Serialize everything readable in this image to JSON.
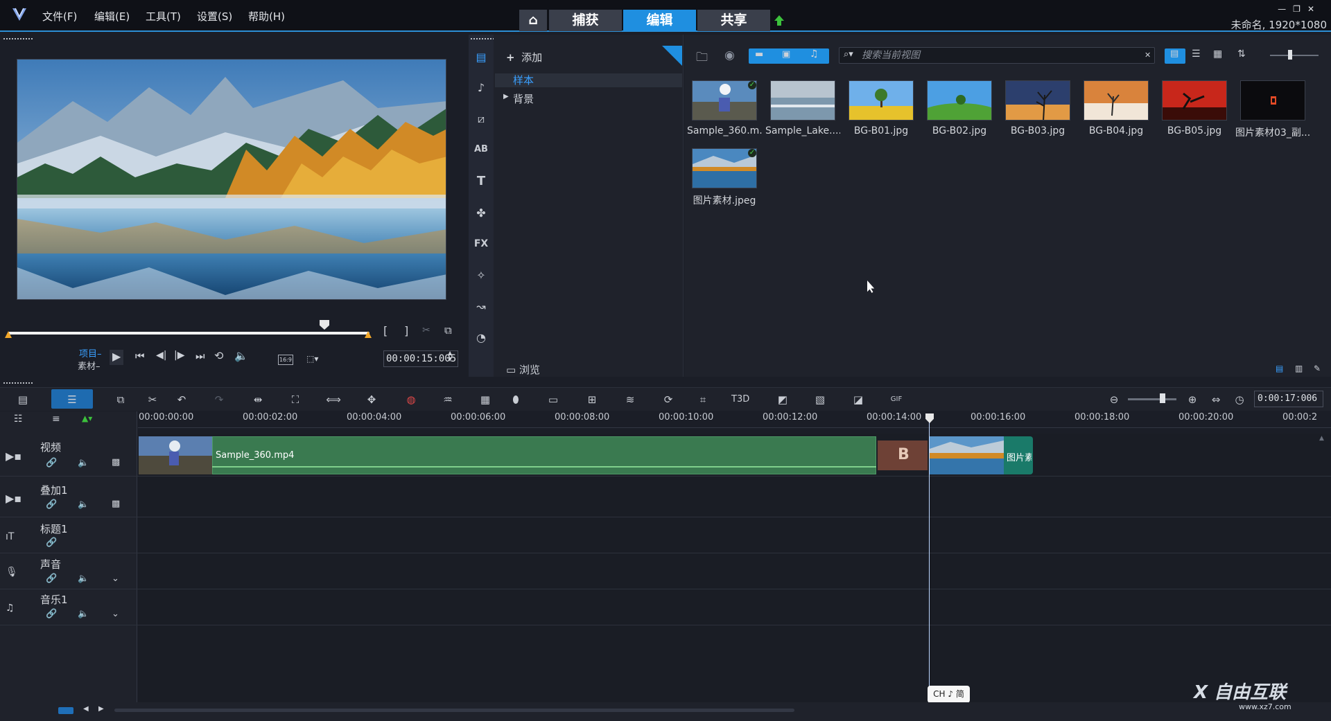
{
  "menu": [
    "文件(F)",
    "编辑(E)",
    "工具(T)",
    "设置(S)",
    "帮助(H)"
  ],
  "mode_tabs": {
    "capture": "捕获",
    "edit": "编辑",
    "share": "共享"
  },
  "project_info": "未命名, 1920*1080",
  "player": {
    "project_label": "项目",
    "clip_label": "素材",
    "timecode": "00:00:15:005",
    "aspect": "16:9"
  },
  "library": {
    "add_label": "添加",
    "tree": {
      "samples": "样本",
      "background": "背景"
    },
    "browse_label": "浏览",
    "search_placeholder": "搜索当前视图",
    "items": [
      {
        "label": "Sample_360.m...",
        "checked": true
      },
      {
        "label": "Sample_Lake....",
        "checked": false
      },
      {
        "label": "BG-B01.jpg",
        "checked": false
      },
      {
        "label": "BG-B02.jpg",
        "checked": false
      },
      {
        "label": "BG-B03.jpg",
        "checked": false
      },
      {
        "label": "BG-B04.jpg",
        "checked": false
      },
      {
        "label": "BG-B05.jpg",
        "checked": false
      },
      {
        "label": "图片素材03_副...",
        "checked": false
      },
      {
        "label": "图片素材.jpeg",
        "checked": true
      }
    ]
  },
  "timeline": {
    "timecode": "0:00:17:006",
    "ruler": [
      "00:00:00:00",
      "00:00:02:00",
      "00:00:04:00",
      "00:00:06:00",
      "00:00:08:00",
      "00:00:10:00",
      "00:00:12:00",
      "00:00:14:00",
      "00:00:16:00",
      "00:00:18:00",
      "00:00:20:00",
      "00:00:2"
    ],
    "tracks": [
      "视频",
      "叠加1",
      "标题1",
      "声音",
      "音乐1"
    ],
    "clips": {
      "video": "Sample_360.mp4",
      "image": "图片素"
    },
    "transition_letter": "B"
  },
  "ime": "CH ♪ 简",
  "watermark": {
    "main": "X 自由互联",
    "sub": "www.xz7.com"
  },
  "colors": {
    "accent": "#1f8fe0",
    "video_clip": "#3a7a50",
    "image_clip": "#1a7a69"
  }
}
